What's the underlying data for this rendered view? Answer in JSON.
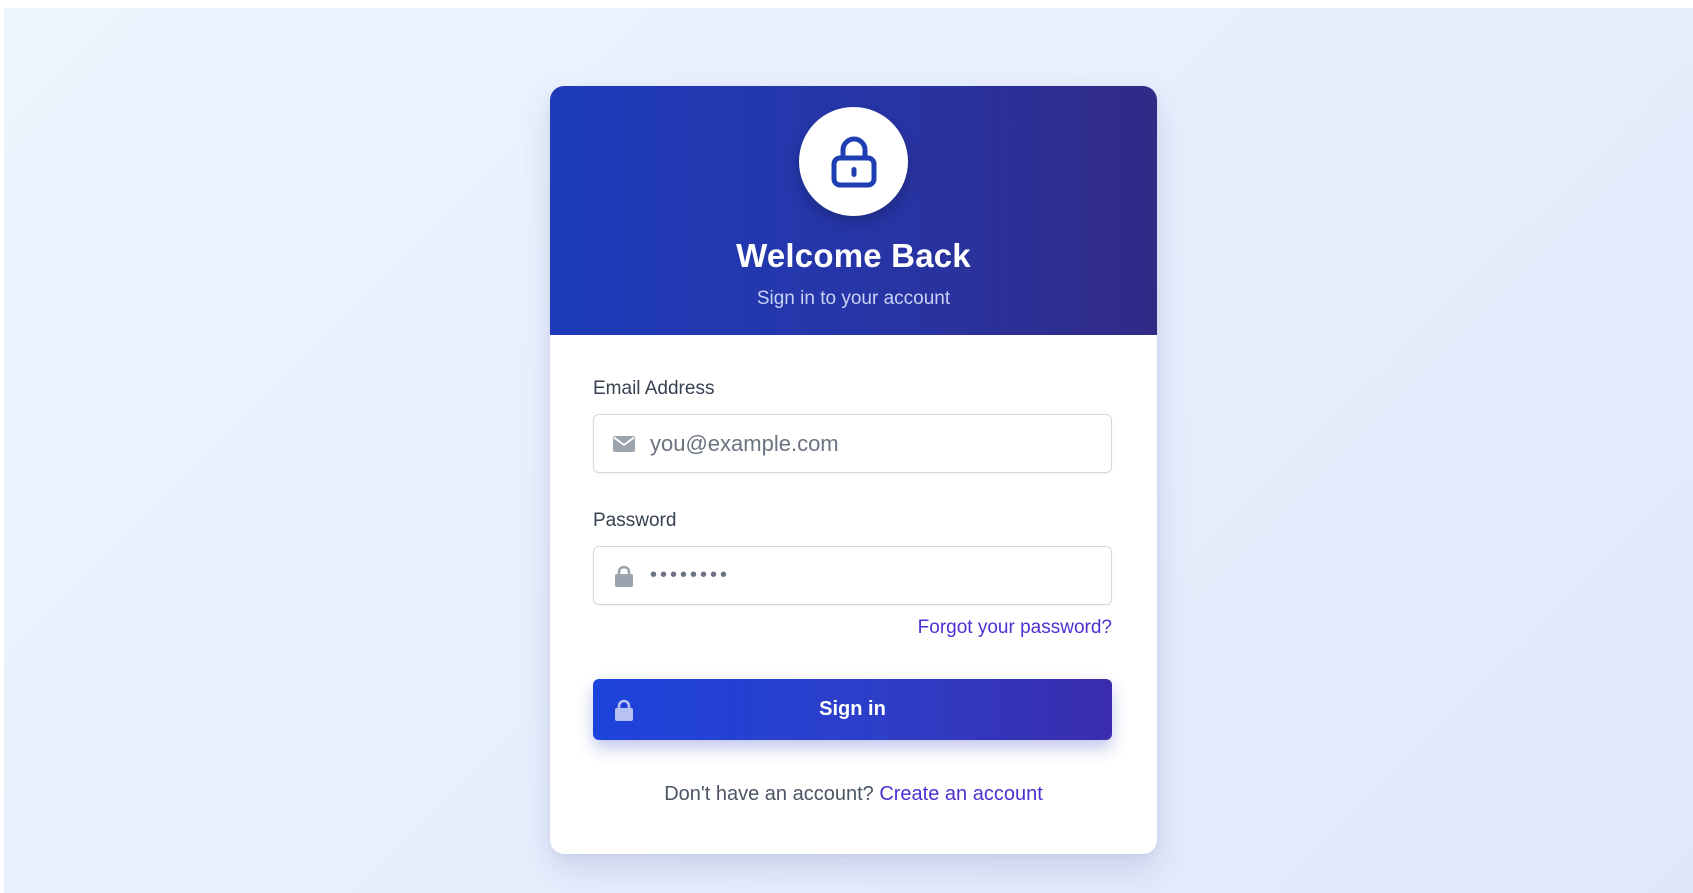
{
  "header": {
    "title": "Welcome Back",
    "subtitle": "Sign in to your account",
    "icon": "lock-icon"
  },
  "form": {
    "email": {
      "label": "Email Address",
      "placeholder": "you@example.com",
      "icon": "mail-icon"
    },
    "password": {
      "label": "Password",
      "value": "••••••••",
      "icon": "lock-icon"
    },
    "forgot_link": "Forgot your password?",
    "submit": {
      "label": "Sign in",
      "icon": "lock-icon"
    }
  },
  "footer": {
    "prompt": "Don't have an account?",
    "link": "Create an account"
  },
  "colors": {
    "header_gradient_start": "#1c3ab9",
    "header_gradient_end": "#312a86",
    "link": "#4f2fd1",
    "button_gradient_start": "#1c43dc",
    "button_gradient_end": "#3a2cad",
    "background": "#e8effd"
  }
}
